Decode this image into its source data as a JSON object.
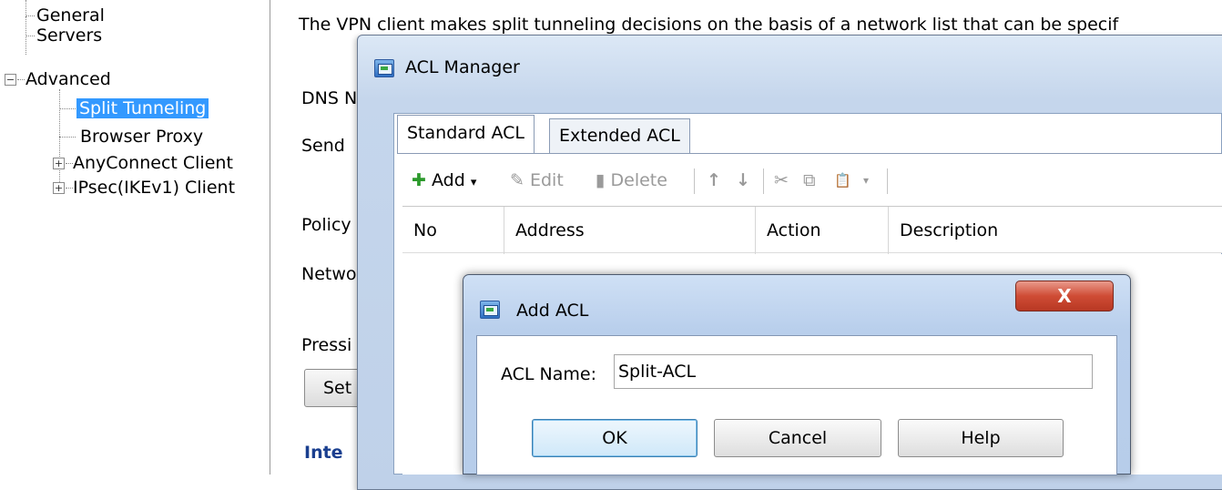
{
  "tree": {
    "items": [
      {
        "label": "General"
      },
      {
        "label": "Servers"
      },
      {
        "label": "Advanced"
      },
      {
        "label": "Split Tunneling",
        "selected": true
      },
      {
        "label": "Browser Proxy"
      },
      {
        "label": "AnyConnect Client"
      },
      {
        "label": "IPsec(IKEv1) Client"
      }
    ],
    "expand_symbols": {
      "collapsed": "+",
      "expanded": "−"
    }
  },
  "panel": {
    "description": "The VPN client makes split tunneling decisions on the basis of a network list that can be specif",
    "dns_label": "DNS N",
    "send_label": "Send",
    "policy_label": "Policy",
    "network_label": "Netwo",
    "press_label": "Pressi",
    "set_button": "Set",
    "inte_label": "Inte"
  },
  "acl_manager": {
    "title": "ACL Manager",
    "tabs": [
      "Standard ACL",
      "Extended ACL"
    ],
    "toolbar": {
      "add": "Add",
      "add_caret": "▾",
      "edit": "Edit",
      "delete": "Delete",
      "move_up": "↑",
      "move_down": "↓",
      "cut": "✂",
      "copy": "⧉",
      "paste": "📋",
      "paste_caret": "▾"
    },
    "columns": [
      "No",
      "Address",
      "Action",
      "Description"
    ]
  },
  "add_acl_dialog": {
    "title": "Add ACL",
    "close_symbol": "X",
    "name_label": "ACL Name:",
    "name_value": "Split-ACL",
    "ok": "OK",
    "cancel": "Cancel",
    "help": "Help"
  },
  "colors": {
    "selection": "#3399ff",
    "add_icon": "#2c9a2c",
    "close_button": "#cf4c35"
  }
}
